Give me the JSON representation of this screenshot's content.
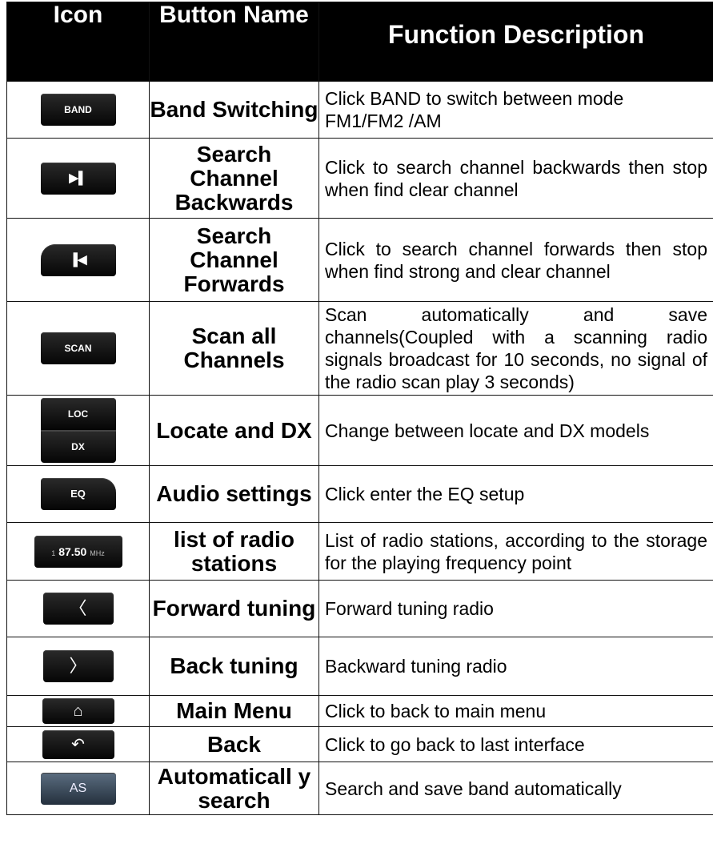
{
  "header": {
    "icon": "Icon",
    "button_name": "Button Name",
    "function_description": "Function Description"
  },
  "rows": [
    {
      "icon_label": "BAND",
      "icon": "band-button-icon",
      "name": "Band Switching",
      "desc": "Click BAND to switch between mode FM1/FM2 /AM"
    },
    {
      "icon_label": "▶▌",
      "icon": "next-track-icon",
      "name": "Search Channel Backwards",
      "desc": "Click to search channel backwards then stop when find clear channel"
    },
    {
      "icon_label": "▐◀",
      "icon": "previous-track-icon",
      "name": "Search Channel Forwards",
      "desc": "Click to search channel forwards then stop when find strong and clear channel"
    },
    {
      "icon_label": "SCAN",
      "icon": "scan-button-icon",
      "name": "Scan all Channels",
      "desc": "Scan automatically and save channels(Coupled with a scanning radio signals broadcast for 10 seconds, no signal of the radio scan play 3 seconds)"
    },
    {
      "icon_label_top": "LOC",
      "icon_label_bottom": "DX",
      "icon": "loc-dx-button-icon",
      "name": "Locate and DX",
      "desc": "Change between locate and DX models"
    },
    {
      "icon_label": "EQ",
      "icon": "eq-button-icon",
      "name": "Audio settings",
      "desc": "Click enter the EQ setup"
    },
    {
      "icon_label_pre": "1",
      "icon_label": "87.50",
      "icon_label_unit": "MHz",
      "icon": "frequency-display-icon",
      "name": "list of radio stations",
      "desc": "List of radio stations, according to the storage for the playing frequency point"
    },
    {
      "icon_label": "〈",
      "icon": "chevron-left-icon",
      "name": "Forward tuning",
      "desc": "Forward tuning radio"
    },
    {
      "icon_label": "〉",
      "icon": "chevron-right-icon",
      "name": "Back tuning",
      "desc": "Backward tuning radio"
    },
    {
      "icon_label": "⌂",
      "icon": "home-icon",
      "name": "Main Menu",
      "desc": "Click to back to main menu"
    },
    {
      "icon_label": "↶",
      "icon": "back-arrow-icon",
      "name": "Back",
      "desc": "Click to go back to last interface"
    },
    {
      "icon_label": "AS",
      "icon": "auto-search-button-icon",
      "name": "Automaticall y search",
      "desc": "Search and save band automatically"
    }
  ]
}
